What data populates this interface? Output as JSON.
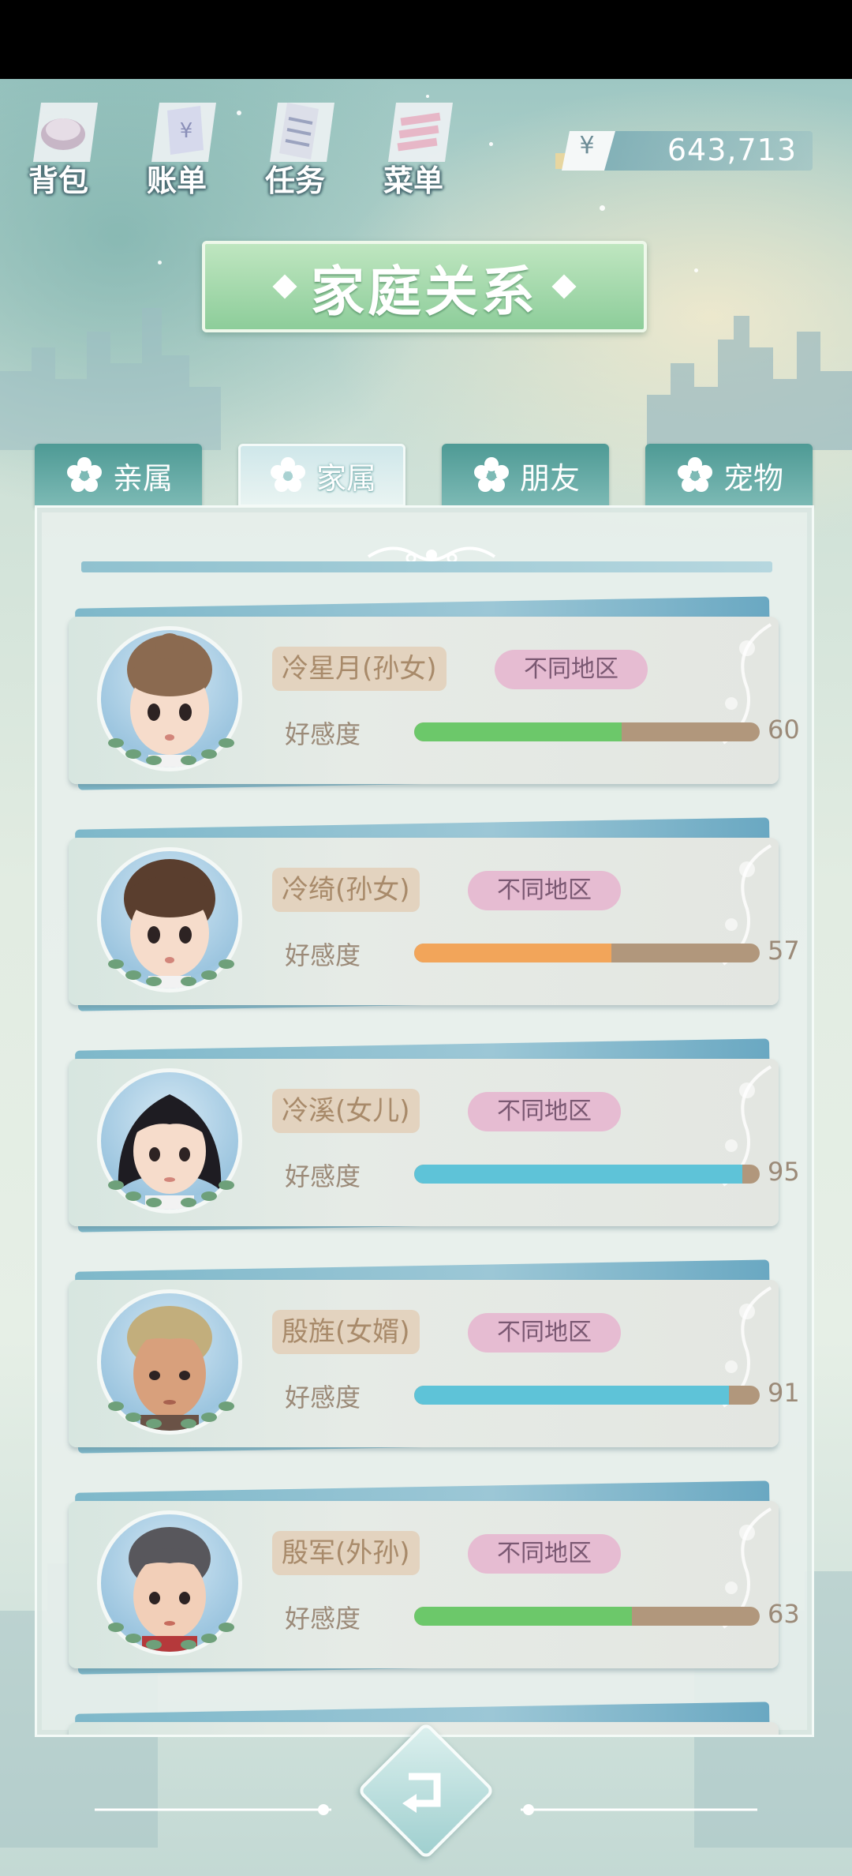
{
  "hud": {
    "buttons": [
      {
        "label": "背包",
        "icon": "bag-icon"
      },
      {
        "label": "账单",
        "icon": "bill-icon"
      },
      {
        "label": "任务",
        "icon": "task-icon"
      },
      {
        "label": "菜单",
        "icon": "menu-icon"
      }
    ],
    "currency_symbol": "¥",
    "money": "643,713"
  },
  "title": "家庭关系",
  "tabs": [
    {
      "label": "亲属",
      "active": false
    },
    {
      "label": "家属",
      "active": true
    },
    {
      "label": "朋友",
      "active": false
    },
    {
      "label": "宠物",
      "active": false
    }
  ],
  "affinity_label": "好感度",
  "members": [
    {
      "name": "冷星月(孙女)",
      "region": "不同地区",
      "affinity": 60,
      "bar_color": "#6cc86a"
    },
    {
      "name": "冷绮(孙女)",
      "region": "不同地区",
      "affinity": 57,
      "bar_color": "#f2a55a"
    },
    {
      "name": "冷溪(女儿)",
      "region": "不同地区",
      "affinity": 95,
      "bar_color": "#5ec3d8"
    },
    {
      "name": "殷旌(女婿)",
      "region": "不同地区",
      "affinity": 91,
      "bar_color": "#5ec3d8"
    },
    {
      "name": "殷军(外孙)",
      "region": "不同地区",
      "affinity": 63,
      "bar_color": "#6cc86a"
    }
  ],
  "colors": {
    "accent_green": "#8dcd9a",
    "tab_teal": "#4e9a95",
    "name_tag": "#e3d3bf",
    "region_tag": "#e6bcd2"
  }
}
